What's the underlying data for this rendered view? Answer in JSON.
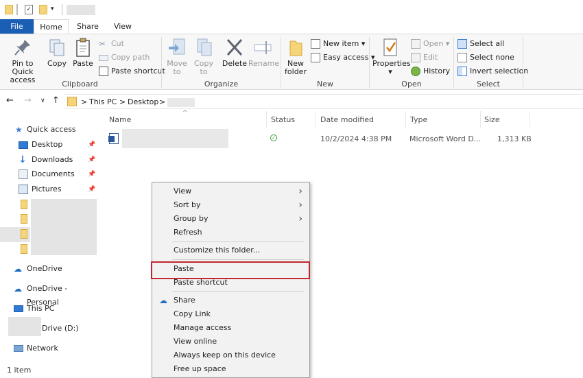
{
  "tabs": {
    "file": "File",
    "home": "Home",
    "share": "Share",
    "view": "View"
  },
  "ribbon": {
    "clipboard": {
      "label": "Clipboard",
      "pin_line1": "Pin to Quick",
      "pin_line2": "access",
      "copy": "Copy",
      "paste": "Paste",
      "cut": "Cut",
      "copy_path": "Copy path",
      "paste_shortcut": "Paste shortcut"
    },
    "organize": {
      "label": "Organize",
      "move_line1": "Move",
      "move_line2": "to",
      "copy_line1": "Copy",
      "copy_line2": "to",
      "delete": "Delete",
      "rename": "Rename"
    },
    "new": {
      "label": "New",
      "new_line1": "New",
      "new_line2": "folder",
      "new_item": "New item",
      "easy_access": "Easy access"
    },
    "open": {
      "label": "Open",
      "properties": "Properties",
      "open": "Open",
      "edit": "Edit",
      "history": "History"
    },
    "select": {
      "label": "Select",
      "select_all": "Select all",
      "select_none": "Select none",
      "invert": "Invert selection"
    }
  },
  "address": {
    "crumb1": "This PC",
    "crumb2": "Desktop",
    "sep": ">"
  },
  "nav": {
    "quick_access": "Quick access",
    "desktop": "Desktop",
    "downloads": "Downloads",
    "documents": "Documents",
    "pictures": "Pictures",
    "onedrive": "OneDrive",
    "onedrive_personal": "OneDrive - Personal",
    "this_pc": "This PC",
    "drive": "Drive (D:)",
    "network": "Network"
  },
  "columns": {
    "name": "Name",
    "status": "Status",
    "date": "Date modified",
    "type": "Type",
    "size": "Size"
  },
  "file": {
    "date": "10/2/2024 4:38 PM",
    "type": "Microsoft Word D...",
    "size": "1,313 KB"
  },
  "menu": {
    "view": "View",
    "sort_by": "Sort by",
    "group_by": "Group by",
    "refresh": "Refresh",
    "customize": "Customize this folder...",
    "paste": "Paste",
    "paste_shortcut": "Paste shortcut",
    "share": "Share",
    "copy_link": "Copy Link",
    "manage_access": "Manage access",
    "view_online": "View online",
    "always_keep": "Always keep on this device",
    "free_up": "Free up space"
  },
  "status": {
    "count": "1 item"
  },
  "colors": {
    "file_tab": "#1a5fb4",
    "highlight": "#c2262e",
    "menu_bg": "#f2f2f2"
  }
}
